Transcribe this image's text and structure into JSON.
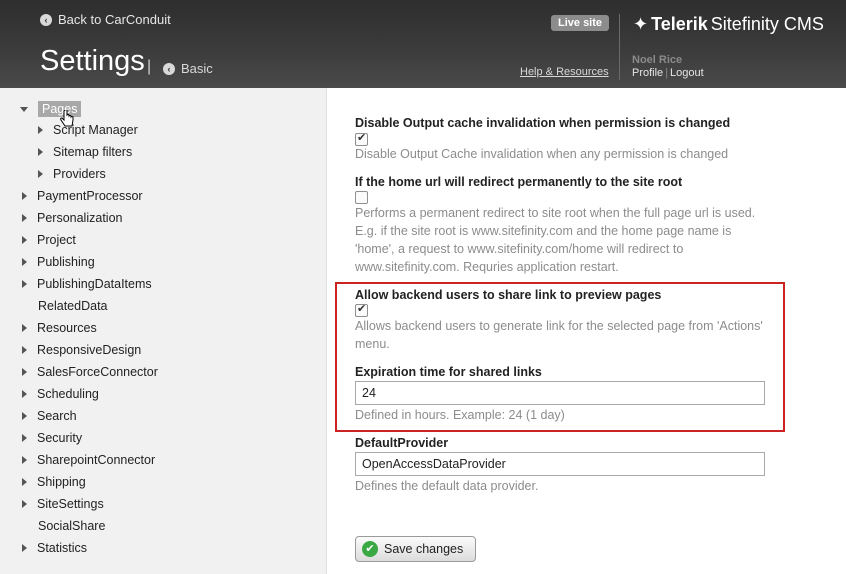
{
  "header": {
    "back_link": "Back to CarConduit",
    "title": "Settings",
    "title_separator": "|",
    "basic_link": "Basic",
    "live_site": "Live site",
    "help_link": "Help & Resources",
    "logo_brand": "Telerik",
    "logo_product": "Sitefinity CMS",
    "user_name": "Noel Rice",
    "profile_link": "Profile",
    "logout_link": "Logout"
  },
  "sidebar": {
    "items": [
      {
        "label": "Pages",
        "arrow": "down",
        "selected": true
      },
      {
        "label": "Script Manager",
        "arrow": "right",
        "indent": true
      },
      {
        "label": "Sitemap filters",
        "arrow": "right",
        "indent": true
      },
      {
        "label": "Providers",
        "arrow": "right",
        "indent": true
      },
      {
        "label": "PaymentProcessor",
        "arrow": "right"
      },
      {
        "label": "Personalization",
        "arrow": "right"
      },
      {
        "label": "Project",
        "arrow": "right"
      },
      {
        "label": "Publishing",
        "arrow": "right"
      },
      {
        "label": "PublishingDataItems",
        "arrow": "right"
      },
      {
        "label": "RelatedData",
        "arrow": "none"
      },
      {
        "label": "Resources",
        "arrow": "right"
      },
      {
        "label": "ResponsiveDesign",
        "arrow": "right"
      },
      {
        "label": "SalesForceConnector",
        "arrow": "right"
      },
      {
        "label": "Scheduling",
        "arrow": "right"
      },
      {
        "label": "Search",
        "arrow": "right"
      },
      {
        "label": "Security",
        "arrow": "right"
      },
      {
        "label": "SharepointConnector",
        "arrow": "right"
      },
      {
        "label": "Shipping",
        "arrow": "right"
      },
      {
        "label": "SiteSettings",
        "arrow": "right"
      },
      {
        "label": "SocialShare",
        "arrow": "none"
      },
      {
        "label": "Statistics",
        "arrow": "right"
      }
    ]
  },
  "settings": {
    "disable_cache": {
      "label": "Disable Output cache invalidation when permission is changed",
      "checked": true,
      "desc": "Disable Output Cache invalidation when any permission is changed"
    },
    "home_redirect": {
      "label": "If the home url will redirect permanently to the site root",
      "checked": false,
      "desc1": "Performs a permanent redirect to site root when the full page url is used.",
      "desc2": "E.g. if the site root is www.sitefinity.com and the home page name is",
      "desc3": "'home', a request to www.sitefinity.com/home will redirect to",
      "desc4": "www.sitefinity.com. Requries application restart."
    },
    "share_preview": {
      "label": "Allow backend users to share link to preview pages",
      "checked": true,
      "desc1": "Allows backend users to generate link for the selected page from 'Actions'",
      "desc2": "menu."
    },
    "expiration": {
      "label": "Expiration time for shared links",
      "value": "24",
      "desc": "Defined in hours. Example: 24 (1 day)"
    },
    "default_provider": {
      "label": "DefaultProvider",
      "value": "OpenAccessDataProvider",
      "desc": "Defines the default data provider."
    }
  },
  "save_button": "Save changes",
  "colors": {
    "header_bg": "#3b3b3b",
    "sidebar_bg": "#f1f1f1",
    "highlight_border": "#cc2222",
    "save_icon": "#3aa843"
  }
}
